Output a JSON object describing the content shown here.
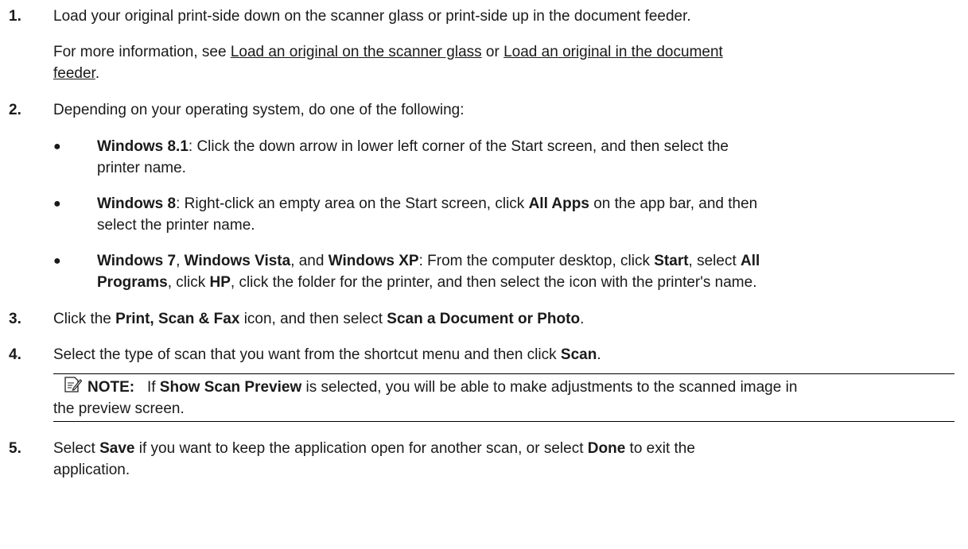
{
  "steps": [
    {
      "number": "1.",
      "text": "Load your original print-side down on the scanner glass or print-side up in the document feeder.",
      "more_prefix": "For more information, see ",
      "link1": "Load an original on the scanner glass",
      "or": " or ",
      "link2_line1": "Load an original in the document",
      "link2_line2": "feeder",
      "end": "."
    },
    {
      "number": "2.",
      "text": "Depending on your operating system, do one of the following:"
    },
    {
      "number": "3.",
      "p1": "Click the ",
      "b1": "Print, Scan & Fax",
      "p2": " icon, and then select ",
      "b2": "Scan a Document or Photo",
      "p3": "."
    },
    {
      "number": "4.",
      "p1": "Select the type of scan that you want from the shortcut menu and then click ",
      "b1": "Scan",
      "p2": "."
    },
    {
      "number": "5.",
      "p1": "Select ",
      "b1": "Save",
      "p2": " if you want to keep the application open for another scan, or select ",
      "b2": "Done",
      "p3": " to exit the",
      "line2": "application."
    }
  ],
  "bullets": [
    {
      "marker": "●",
      "b1": "Windows 8.1",
      "t1": ": Click the down arrow in lower left corner of the Start screen, and then select the",
      "t2": "printer name."
    },
    {
      "marker": "●",
      "b1": "Windows 8",
      "t1": ": Right-click an empty area on the Start screen, click ",
      "b2": "All Apps",
      "t2": " on the app bar, and then",
      "t3": "select the printer name."
    },
    {
      "marker": "●",
      "b1": "Windows 7",
      "s1": ", ",
      "b2": "Windows Vista",
      "s2": ", and ",
      "b3": "Windows XP",
      "t1": ": From the computer desktop, click ",
      "b4": "Start",
      "t2": ", select ",
      "b5": "All",
      "b6": "Programs",
      "t3": ", click ",
      "b7": "HP",
      "t4": ", click the folder for the printer, and then select the icon with the printer's name."
    }
  ],
  "note": {
    "icon": "note-pencil-icon",
    "label": "NOTE:",
    "gap": "   If ",
    "b1": "Show Scan Preview",
    "t1": " is selected, you will be able to make adjustments to the scanned image in",
    "t2": "the preview screen."
  }
}
